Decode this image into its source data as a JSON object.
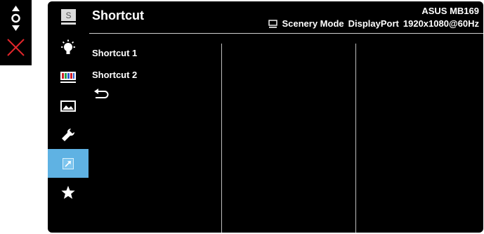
{
  "header": {
    "title": "Shortcut",
    "model": "ASUS MB169",
    "status": {
      "mode": "Scenery Mode",
      "input": "DisplayPort",
      "resolution": "1920x1080@60Hz"
    }
  },
  "keypad": {
    "icons": [
      "navigate-icon",
      "close-icon"
    ]
  },
  "sidebar": {
    "items": [
      {
        "icon": "lightbulb-icon",
        "active": false
      },
      {
        "icon": "color-bars-icon",
        "active": false
      },
      {
        "icon": "image-icon",
        "active": false
      },
      {
        "icon": "wrench-icon",
        "active": false
      },
      {
        "icon": "shortcut-arrow-icon",
        "active": true
      },
      {
        "icon": "star-icon",
        "active": false
      }
    ]
  },
  "menu": {
    "options": [
      "Shortcut 1",
      "Shortcut 2"
    ],
    "back_icon": "back-arrow-icon"
  },
  "colors": {
    "background": "#000000",
    "highlight": "#5fb2e3",
    "text": "#ffffff"
  }
}
